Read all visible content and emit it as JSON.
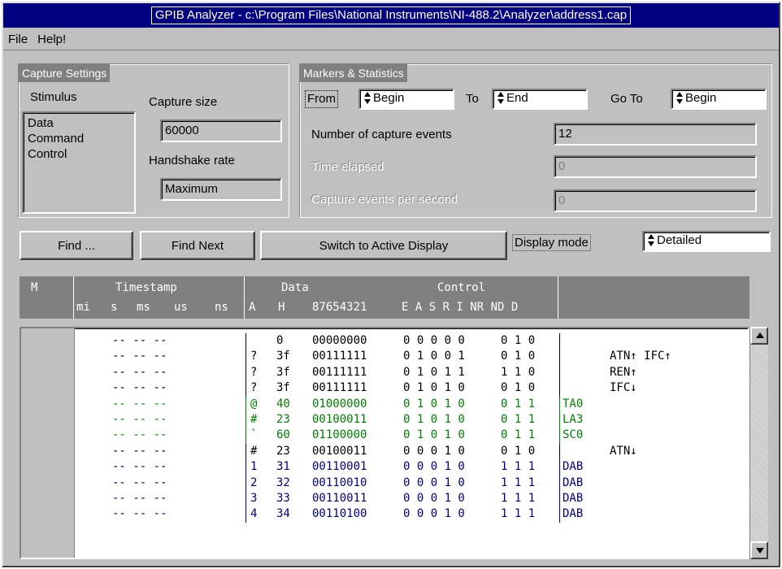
{
  "window": {
    "title": "GPIB Analyzer - c:\\Program Files\\National Instruments\\NI-488.2\\Analyzer\\address1.cap"
  },
  "menu": [
    {
      "label": "File"
    },
    {
      "label": "Help!"
    }
  ],
  "capture": {
    "title": "Capture Settings",
    "stimulus_label": "Stimulus",
    "stimulus_items": [
      "Data",
      "Command",
      "Control"
    ],
    "size_label": "Capture size",
    "size_value": "60000",
    "rate_label": "Handshake rate",
    "rate_value": "Maximum"
  },
  "markers": {
    "title": "Markers & Statistics",
    "from_label": "From",
    "from_value": "Begin",
    "to_label": "To",
    "to_value": "End",
    "goto_label": "Go To",
    "goto_value": "Begin",
    "events_label": "Number of capture events",
    "events_value": "12",
    "elapsed_label": "Time elapsed",
    "elapsed_value": "0",
    "eps_label": "Capture events per second",
    "eps_value": "0"
  },
  "toolbar": {
    "find_label": "Find ...",
    "find_next_label": "Find Next",
    "switch_label": "Switch to Active Display",
    "display_mode_label": "Display mode",
    "display_mode_value": "Detailed"
  },
  "header": {
    "m": "M",
    "timestamp": "Timestamp",
    "mi": "mi",
    "s": "s",
    "ms": "ms",
    "us": "us",
    "ns": "ns",
    "data": "Data",
    "control": "Control",
    "a": "A",
    "h": "H",
    "bits": "87654321",
    "ctrl_bits": "E A S R I NR ND D"
  },
  "rows": [
    {
      "ts": "--  --  --",
      "a": "",
      "h": "0",
      "bin": "00000000",
      "ctl1": "0 0 0 0 0",
      "ctl2": "0 1 0",
      "cmd": "",
      "notes": "",
      "color": "#000000"
    },
    {
      "ts": "--  --  --",
      "a": "?",
      "h": "3f",
      "bin": "00111111",
      "ctl1": "0 1 0 0 1",
      "ctl2": "0 1 0",
      "cmd": "",
      "notes": "ATN↑    IFC↑",
      "color": "#000000"
    },
    {
      "ts": "--  --  --",
      "a": "?",
      "h": "3f",
      "bin": "00111111",
      "ctl1": "0 1 0 1 1",
      "ctl2": "1 1 0",
      "cmd": "",
      "notes": "REN↑",
      "color": "#000000"
    },
    {
      "ts": "--  --  --",
      "a": "?",
      "h": "3f",
      "bin": "00111111",
      "ctl1": "0 1 0 1 0",
      "ctl2": "0 1 0",
      "cmd": "",
      "notes": "IFC↓",
      "color": "#000000"
    },
    {
      "ts": "--  --  --",
      "a": "@",
      "h": "40",
      "bin": "01000000",
      "ctl1": "0 1 0 1 0",
      "ctl2": "0 1 1",
      "cmd": "TA0",
      "notes": "",
      "color": "#008000"
    },
    {
      "ts": "--  --  --",
      "a": "#",
      "h": "23",
      "bin": "00100011",
      "ctl1": "0 1 0 1 0",
      "ctl2": "0 1 1",
      "cmd": "LA3",
      "notes": "",
      "color": "#008000"
    },
    {
      "ts": "--  --  --",
      "a": "`",
      "h": "60",
      "bin": "01100000",
      "ctl1": "0 1 0 1 0",
      "ctl2": "0 1 1",
      "cmd": "SC0",
      "notes": "",
      "color": "#008000"
    },
    {
      "ts": "--  --  --",
      "a": "#",
      "h": "23",
      "bin": "00100011",
      "ctl1": "0 0 0 1 0",
      "ctl2": "0 1 0",
      "cmd": "",
      "notes": "ATN↓",
      "color": "#000000"
    },
    {
      "ts": "--  --  --",
      "a": "1",
      "h": "31",
      "bin": "00110001",
      "ctl1": "0 0 0 1 0",
      "ctl2": "1 1 1",
      "cmd": "DAB",
      "notes": "",
      "color": "#000080"
    },
    {
      "ts": "--  --  --",
      "a": "2",
      "h": "32",
      "bin": "00110010",
      "ctl1": "0 0 0 1 0",
      "ctl2": "1 1 1",
      "cmd": "DAB",
      "notes": "",
      "color": "#000080"
    },
    {
      "ts": "--  --  --",
      "a": "3",
      "h": "33",
      "bin": "00110011",
      "ctl1": "0 0 0 1 0",
      "ctl2": "1 1 1",
      "cmd": "DAB",
      "notes": "",
      "color": "#000080"
    },
    {
      "ts": "--  --  --",
      "a": "4",
      "h": "34",
      "bin": "00110100",
      "ctl1": "0 0 0 1 0",
      "ctl2": "1 1 1",
      "cmd": "DAB",
      "notes": "",
      "color": "#000080"
    }
  ],
  "icons": {
    "scroll_up": "arrow-up-icon",
    "scroll_down": "arrow-down-icon",
    "spin": "spin-arrows-icon"
  }
}
